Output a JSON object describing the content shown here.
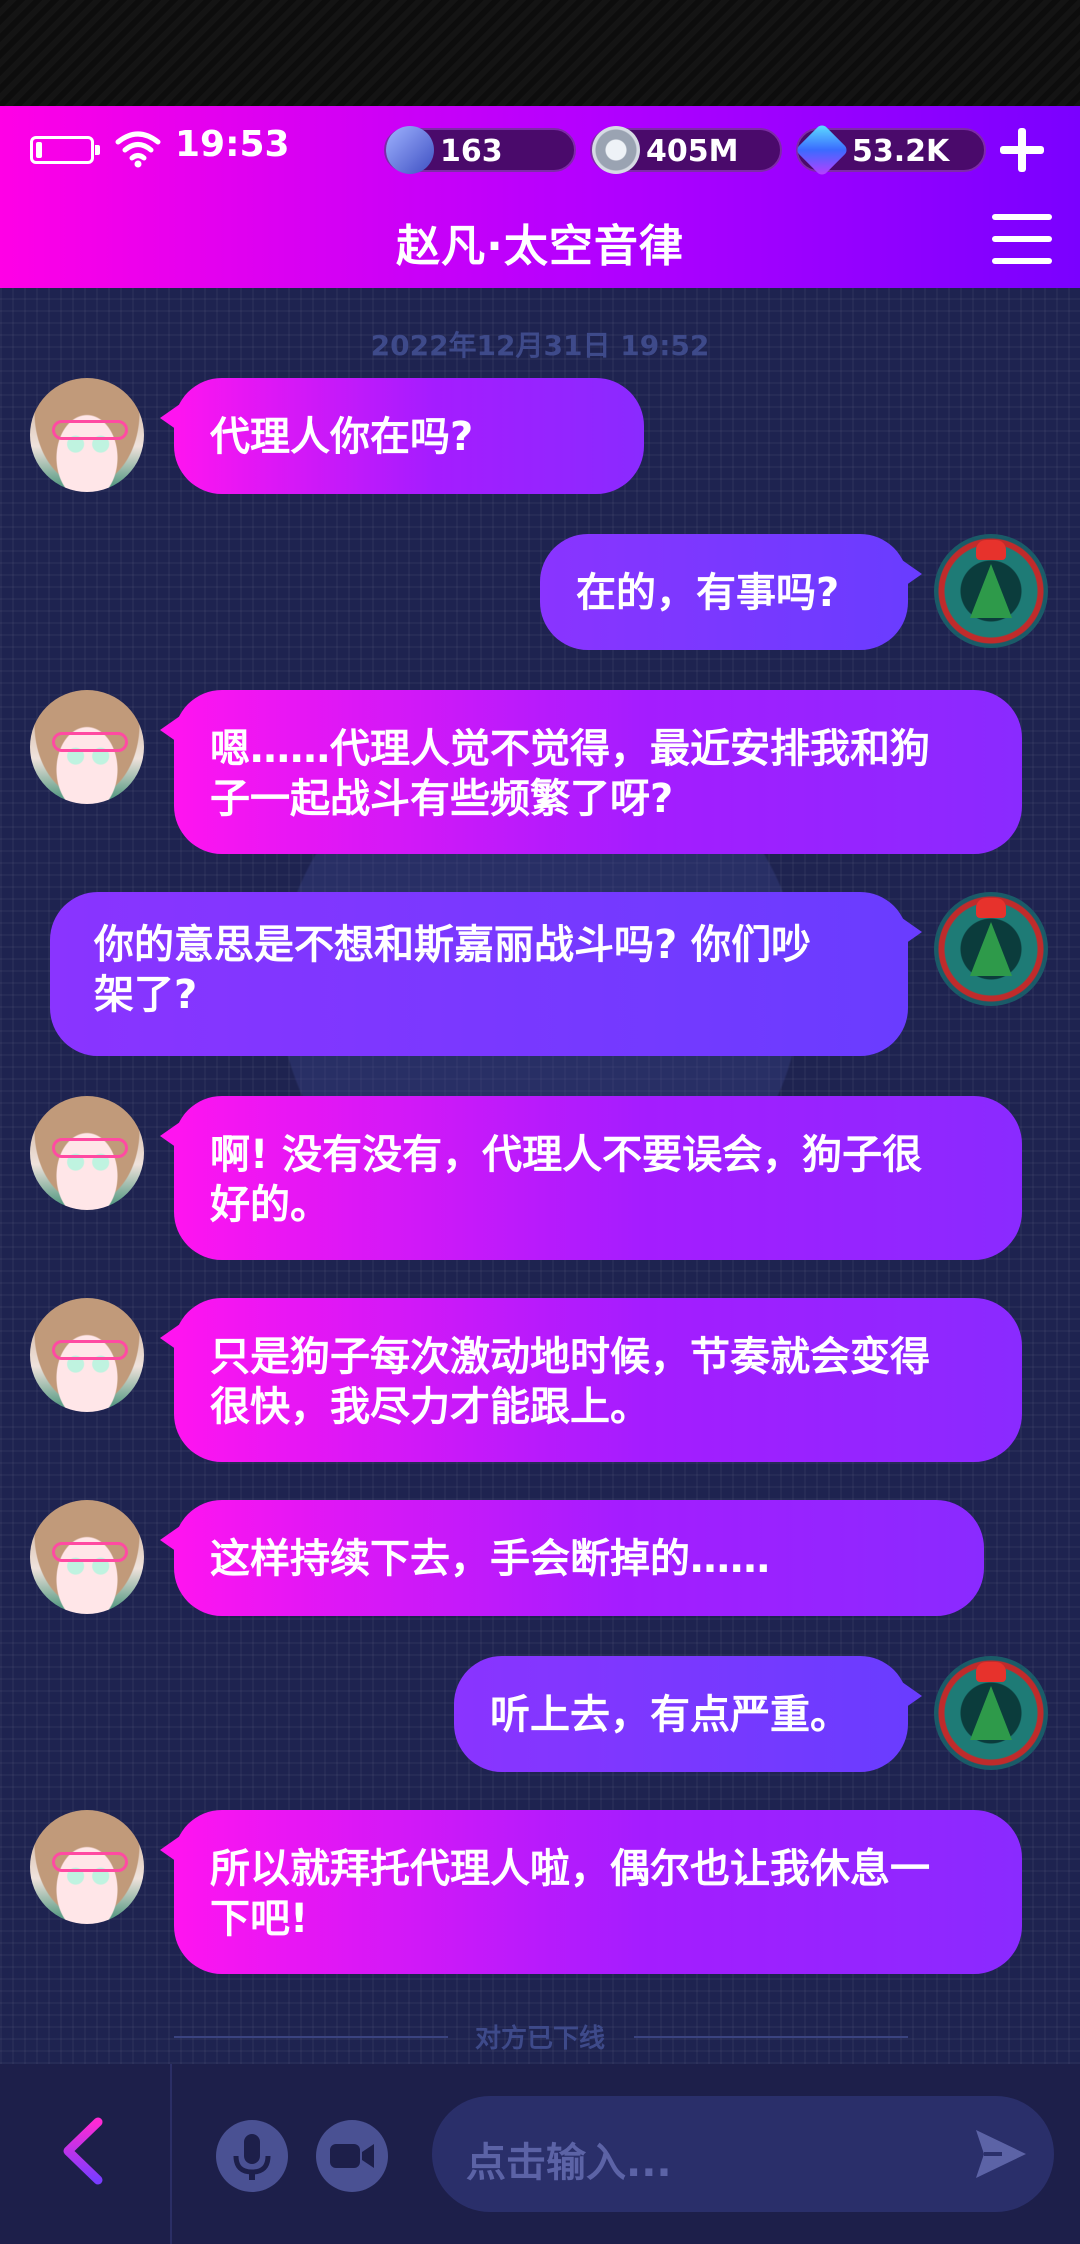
{
  "status_bar": {
    "time": "19:53",
    "battery_level": 0.1
  },
  "resources": [
    {
      "name": "stamina-icon",
      "value": "163"
    },
    {
      "name": "coin-icon",
      "value": "405M"
    },
    {
      "name": "cube-gem-icon",
      "value": "53.2K"
    }
  ],
  "header": {
    "title": "赵凡·太空音律"
  },
  "chat": {
    "timestamp": "2022年12月31日 19:52",
    "messages": [
      {
        "side": "left",
        "lines": [
          "代理人你在吗?"
        ]
      },
      {
        "side": "right",
        "lines": [
          "在的，有事吗?"
        ]
      },
      {
        "side": "left",
        "lines": [
          "嗯……代理人觉不觉得，最近安排我和狗",
          "子一起战斗有些频繁了呀?"
        ]
      },
      {
        "side": "right",
        "lines": [
          "你的意思是不想和斯嘉丽战斗吗? 你们吵",
          "架了?"
        ]
      },
      {
        "side": "left",
        "lines": [
          "啊! 没有没有，代理人不要误会，狗子很",
          "好的。"
        ]
      },
      {
        "side": "left",
        "lines": [
          "只是狗子每次激动地时候，节奏就会变得",
          "很快，我尽力才能跟上。"
        ]
      },
      {
        "side": "left",
        "lines": [
          "这样持续下去，手会断掉的……"
        ]
      },
      {
        "side": "right",
        "lines": [
          "听上去，有点严重。"
        ]
      },
      {
        "side": "left",
        "lines": [
          "所以就拜托代理人啦，偶尔也让我休息一",
          "下吧!"
        ]
      }
    ],
    "status_note": "对方已下线"
  },
  "input": {
    "placeholder": "点击输入..."
  },
  "colors": {
    "header_start": "#ff00e6",
    "header_end": "#7a00ff",
    "bubble_left_start": "#ff14f0",
    "bubble_left_end": "#8a2aff",
    "bubble_right": "#6a3cff",
    "chat_bg": "#1e2350"
  }
}
